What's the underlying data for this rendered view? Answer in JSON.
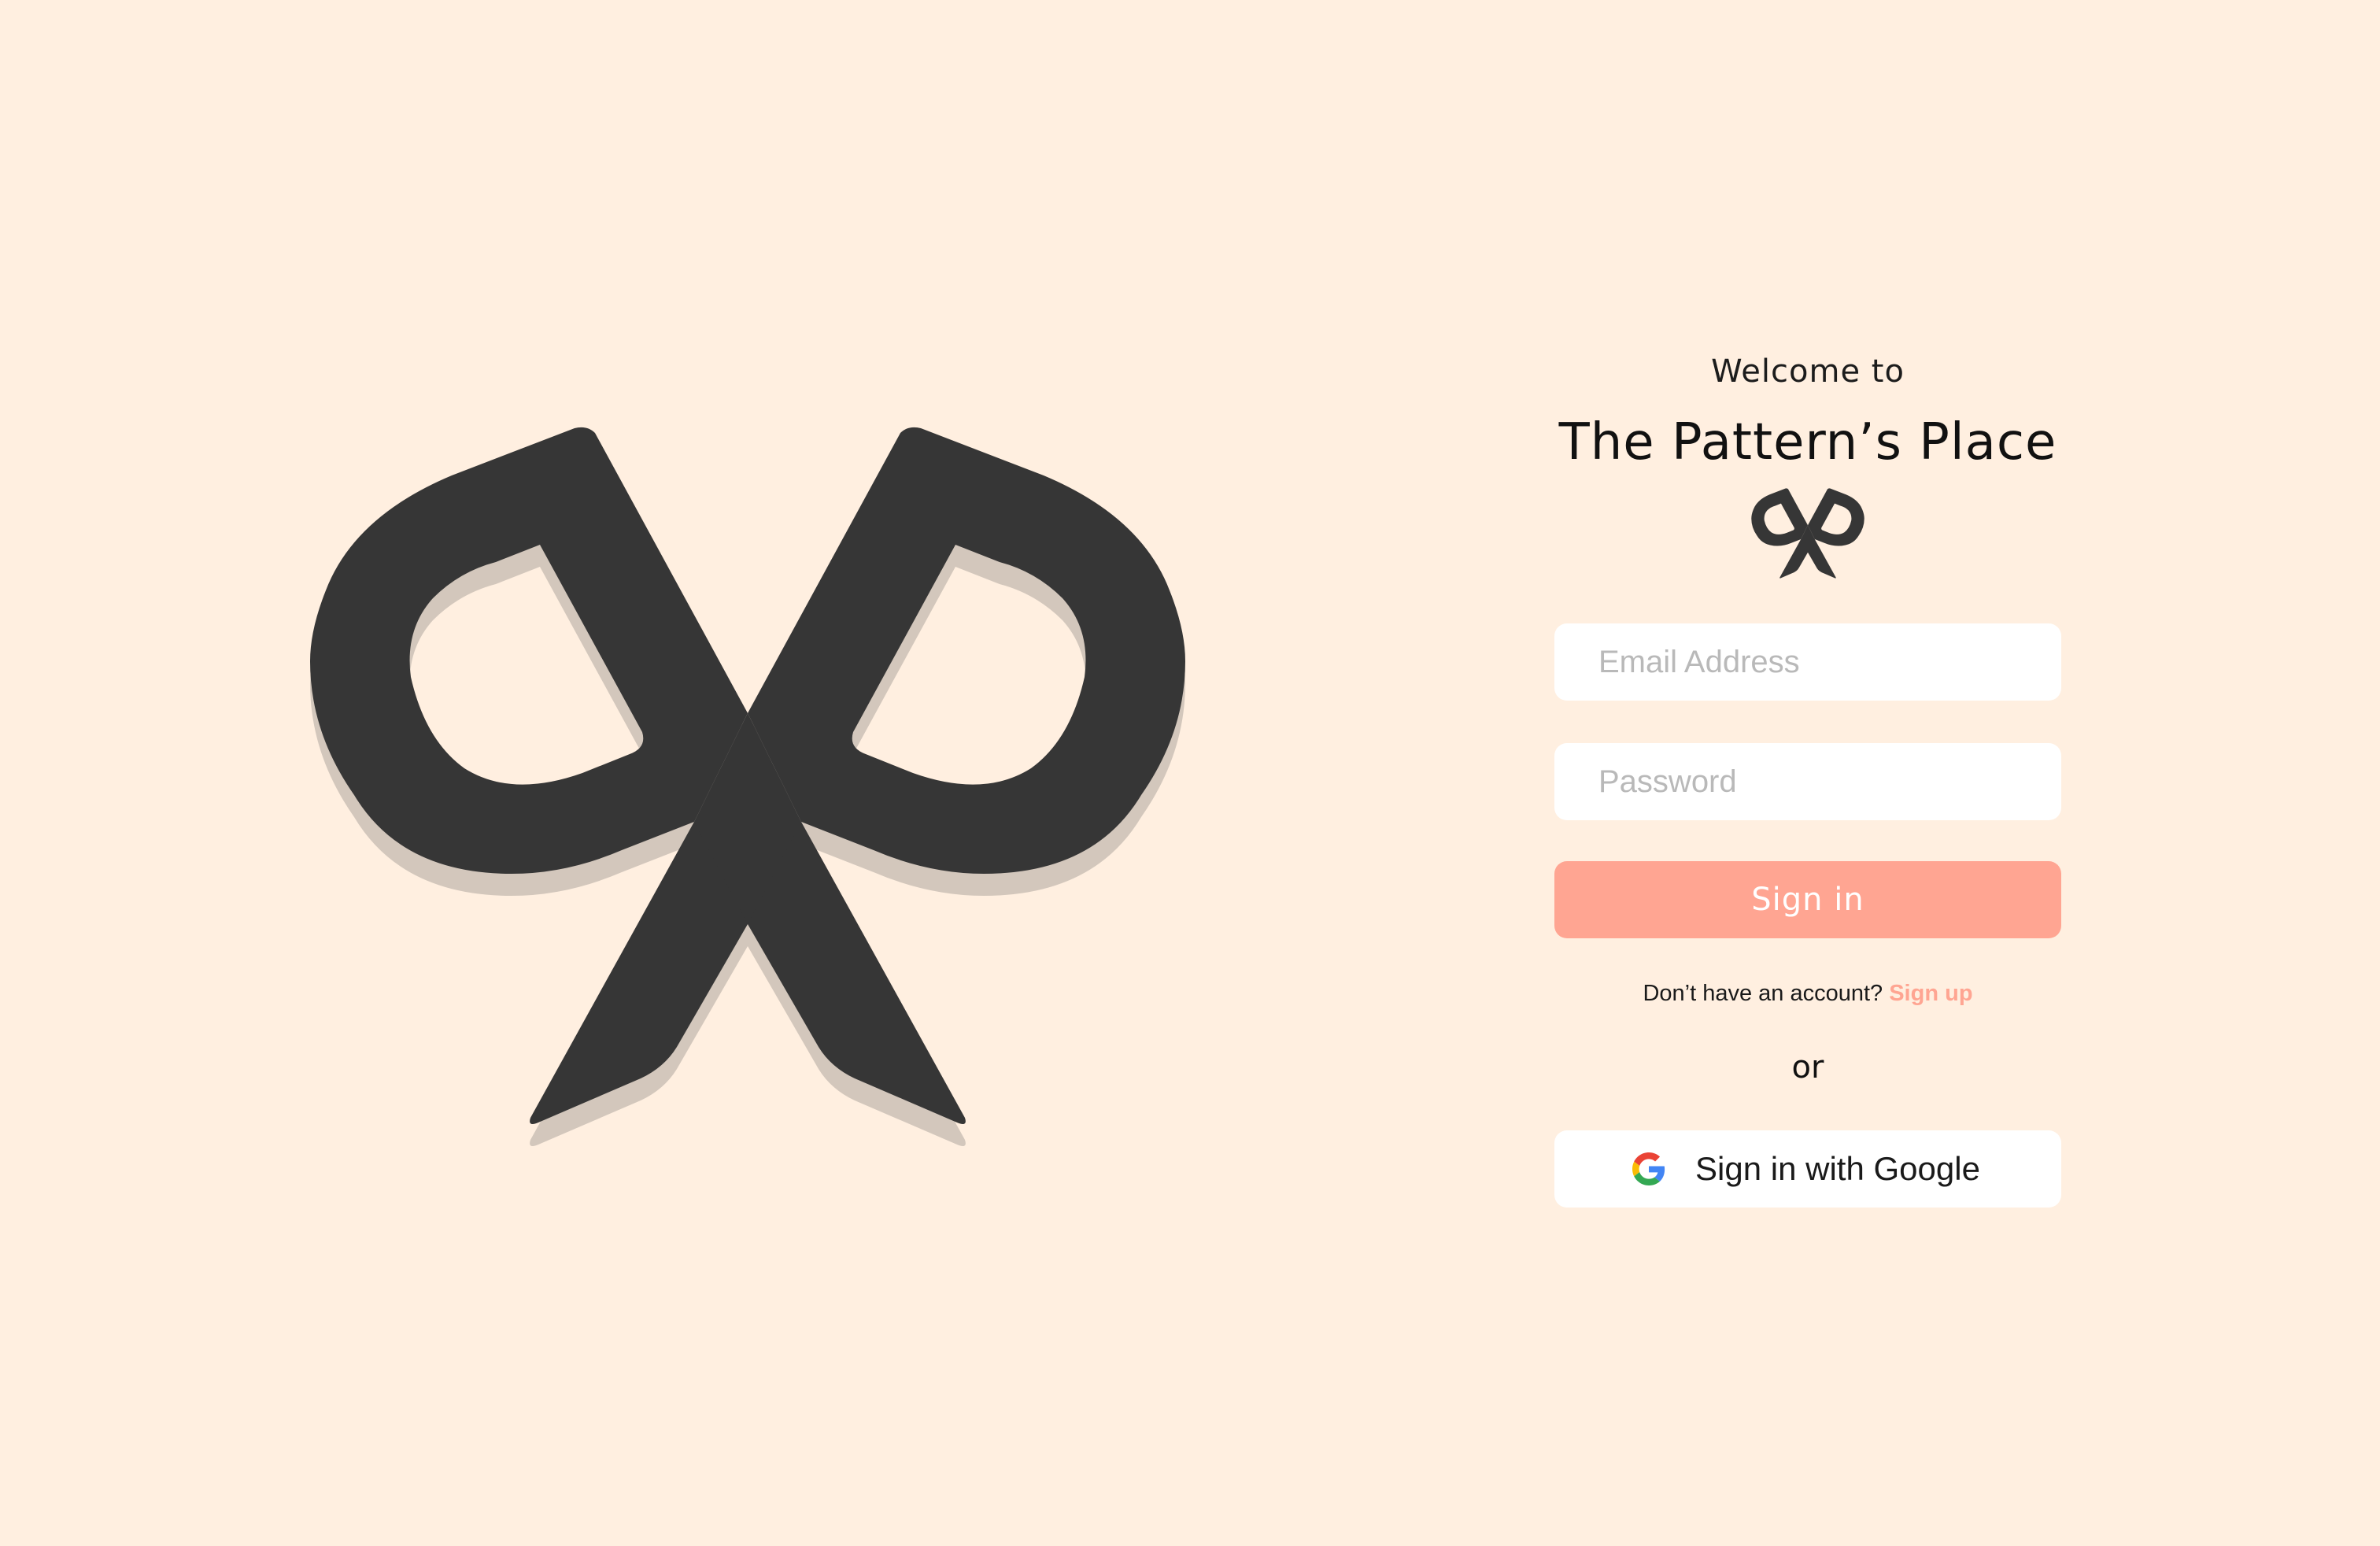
{
  "branding": {
    "welcome_text": "Welcome to",
    "app_name": "The Pattern’s Place",
    "logo_icon": "scissors-icon"
  },
  "login_form": {
    "email_placeholder": "Email Address",
    "email_value": "",
    "password_placeholder": "Password",
    "password_value": "",
    "submit_label": "Sign in"
  },
  "signup_prompt": {
    "text": "Don’t have an account?",
    "link_label": "Sign up"
  },
  "divider_text": "or",
  "google_signin": {
    "label": "Sign in with Google",
    "icon": "google-icon"
  },
  "colors": {
    "background": "#FFEFE0",
    "accent": "#FFA592",
    "logo": "#363636",
    "logo_shadow": "#D3C7BC"
  }
}
